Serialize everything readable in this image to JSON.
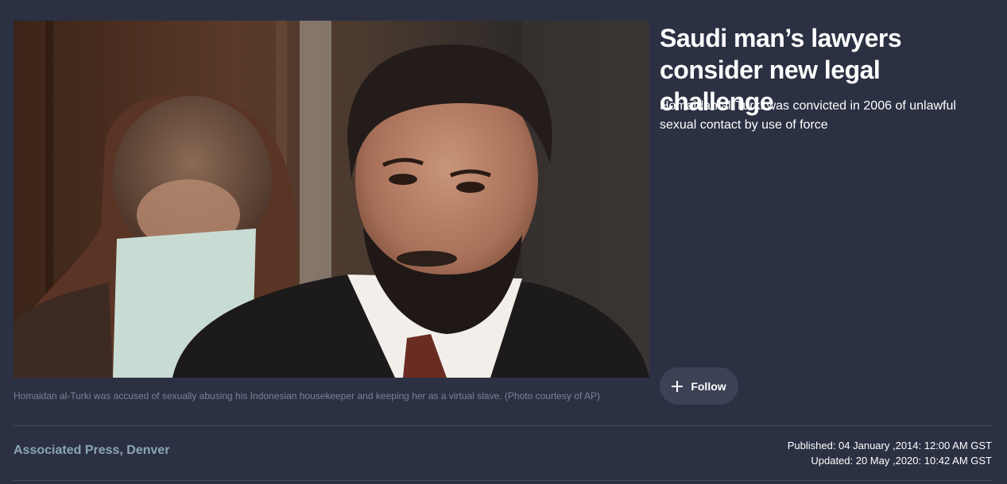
{
  "article": {
    "headline": "Saudi man’s lawyers consider new legal challenge",
    "subheadline": "Homaidan al-Turki was convicted in 2006 of unlawful sexual contact by use of force",
    "image_caption": "Homaidan al-Turki was accused of sexually abusing his Indonesian housekeeper and keeping her as a virtual slave. (Photo courtesy of AP)",
    "follow_label": "Follow",
    "byline": "Associated Press, Denver",
    "published": "Published: 04 January ,2014: 12:00 AM GST",
    "updated": "Updated: 20 May ,2020: 10:42 AM GST"
  },
  "icons": {
    "follow": "plus-icon"
  },
  "colors": {
    "background": "#2b3143",
    "byline": "#8aa4b8",
    "caption": "#7b8295",
    "button": "#3b4255"
  }
}
